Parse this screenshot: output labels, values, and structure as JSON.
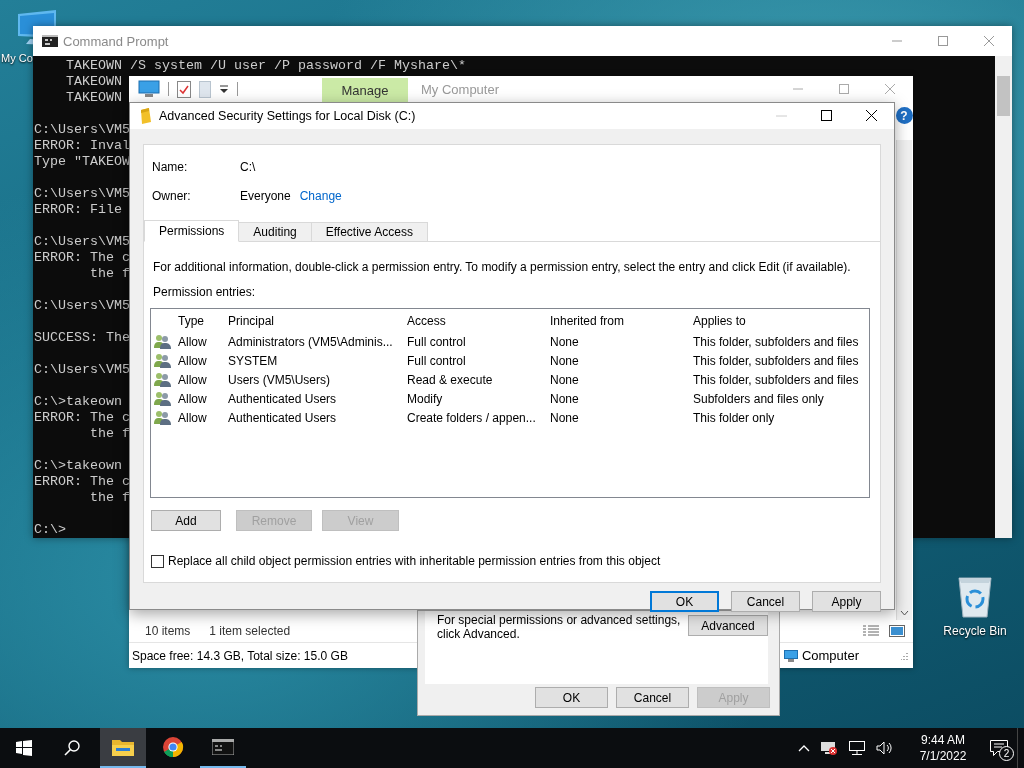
{
  "desktop_icons": [
    {
      "kind": "computer",
      "label": "My Co"
    },
    {
      "kind": "recycle-bin",
      "label": "Recycle Bin"
    }
  ],
  "command_prompt": {
    "title": "Command Prompt",
    "blocks": [
      [
        "    TAKEOWN /S system /U user /P password /F Myshare\\*",
        "    TAKEOWN",
        "    TAKEOWN"
      ],
      [
        "C:\\Users\\VM5",
        "ERROR: Inval",
        "Type \"TAKEOW"
      ],
      [
        "C:\\Users\\VM5",
        "ERROR: File"
      ],
      [
        "C:\\Users\\VM5",
        "ERROR: The c",
        "       the f"
      ],
      [
        "C:\\Users\\VM5"
      ],
      [
        "SUCCESS: The"
      ],
      [
        "C:\\Users\\VM5"
      ],
      [
        "C:\\>takeown",
        "ERROR: The c",
        "       the f"
      ],
      [
        "C:\\>takeown",
        "ERROR: The c",
        "       the f"
      ],
      [
        "C:\\>"
      ]
    ]
  },
  "explorer": {
    "ribbon_tab": "Manage",
    "title": "My Computer",
    "help_label": "?",
    "item_count": "10 items",
    "selection": "1 item selected",
    "space": "Space free: 14.3 GB, Total size: 15.0 GB",
    "location": "Computer"
  },
  "properties_dialog": {
    "note_lines": [
      "For special permissions or advanced settings,",
      "click Advanced."
    ],
    "advanced_button": "Advanced",
    "buttons": [
      {
        "label": "OK",
        "disabled": false
      },
      {
        "label": "Cancel",
        "disabled": false
      },
      {
        "label": "Apply",
        "disabled": true
      }
    ]
  },
  "advanced_dialog": {
    "title": "Advanced Security Settings for Local Disk (C:)",
    "name_label": "Name:",
    "name": "C:\\",
    "owner_label": "Owner:",
    "owner": "Everyone",
    "change_link": "Change",
    "tabs": [
      {
        "label": "Permissions",
        "selected": true
      },
      {
        "label": "Auditing",
        "selected": false
      },
      {
        "label": "Effective Access",
        "selected": false
      }
    ],
    "info": "For additional information, double-click a permission entry. To modify a permission entry, select the entry and click Edit (if available).",
    "entries_label": "Permission entries:",
    "columns": [
      "Type",
      "Principal",
      "Access",
      "Inherited from",
      "Applies to"
    ],
    "rows": [
      {
        "type": "Allow",
        "principal": "Administrators (VM5\\Adminis...",
        "access": "Full control",
        "inherited_from": "None",
        "applies_to": "This folder, subfolders and files",
        "selected": false
      },
      {
        "type": "Allow",
        "principal": "SYSTEM",
        "access": "Full control",
        "inherited_from": "None",
        "applies_to": "This folder, subfolders and files",
        "selected": false
      },
      {
        "type": "Allow",
        "principal": "Users (VM5\\Users)",
        "access": "Read & execute",
        "inherited_from": "None",
        "applies_to": "This folder, subfolders and files",
        "selected": false
      },
      {
        "type": "Allow",
        "principal": "Authenticated Users",
        "access": "Modify",
        "inherited_from": "None",
        "applies_to": "Subfolders and files only",
        "selected": false
      },
      {
        "type": "Allow",
        "principal": "Authenticated Users",
        "access": "Create folders / appen...",
        "inherited_from": "None",
        "applies_to": "This folder only",
        "selected": false
      }
    ],
    "actions": [
      {
        "label": "Add",
        "disabled": false
      },
      {
        "label": "Remove",
        "disabled": true
      },
      {
        "label": "View",
        "disabled": true
      }
    ],
    "replace_checkbox": {
      "label": "Replace all child object permission entries with inheritable permission entries from this object",
      "checked": false
    },
    "buttons": [
      {
        "label": "OK",
        "default": true,
        "disabled": false
      },
      {
        "label": "Cancel",
        "default": false,
        "disabled": false
      },
      {
        "label": "Apply",
        "default": false,
        "disabled": false
      }
    ]
  },
  "taskbar": {
    "apps": [
      {
        "kind": "explorer",
        "active": true,
        "running": true
      },
      {
        "kind": "chrome",
        "active": false,
        "running": false
      },
      {
        "kind": "console",
        "active": false,
        "running": true
      }
    ],
    "time": "9:44 AM",
    "date": "7/1/2022",
    "notification_count": "2"
  }
}
